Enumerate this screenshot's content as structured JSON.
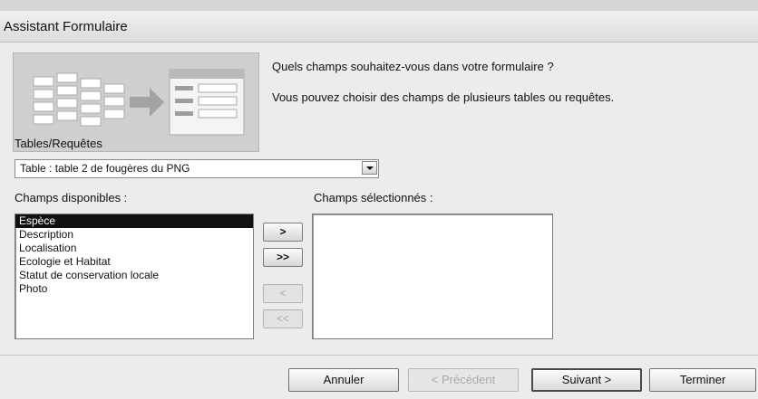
{
  "window": {
    "title": "Assistant Formulaire"
  },
  "intro": {
    "question": "Quels champs souhaitez-vous dans votre formulaire ?",
    "hint": "Vous pouvez choisir des champs de plusieurs tables ou requêtes."
  },
  "tables": {
    "label": "Tables/Requêtes",
    "selected": "Table : table 2 de fougères du PNG"
  },
  "available": {
    "label": "Champs disponibles :",
    "items": [
      "Espèce",
      "Description",
      "Localisation",
      "Ecologie et Habitat",
      "Statut de conservation locale",
      "Photo"
    ],
    "selected_index": 0
  },
  "selected_fields": {
    "label": "Champs sélectionnés :",
    "items": []
  },
  "move_buttons": {
    "add_one": ">",
    "add_all": ">>",
    "remove_one": "<",
    "remove_all": "<<"
  },
  "footer": {
    "cancel": "Annuler",
    "previous": "< Précédent",
    "next": "Suivant >",
    "finish": "Terminer"
  },
  "icons": {
    "wizard_illustration": "table-to-form-icon",
    "combo_arrow": "chevron-down-icon"
  }
}
